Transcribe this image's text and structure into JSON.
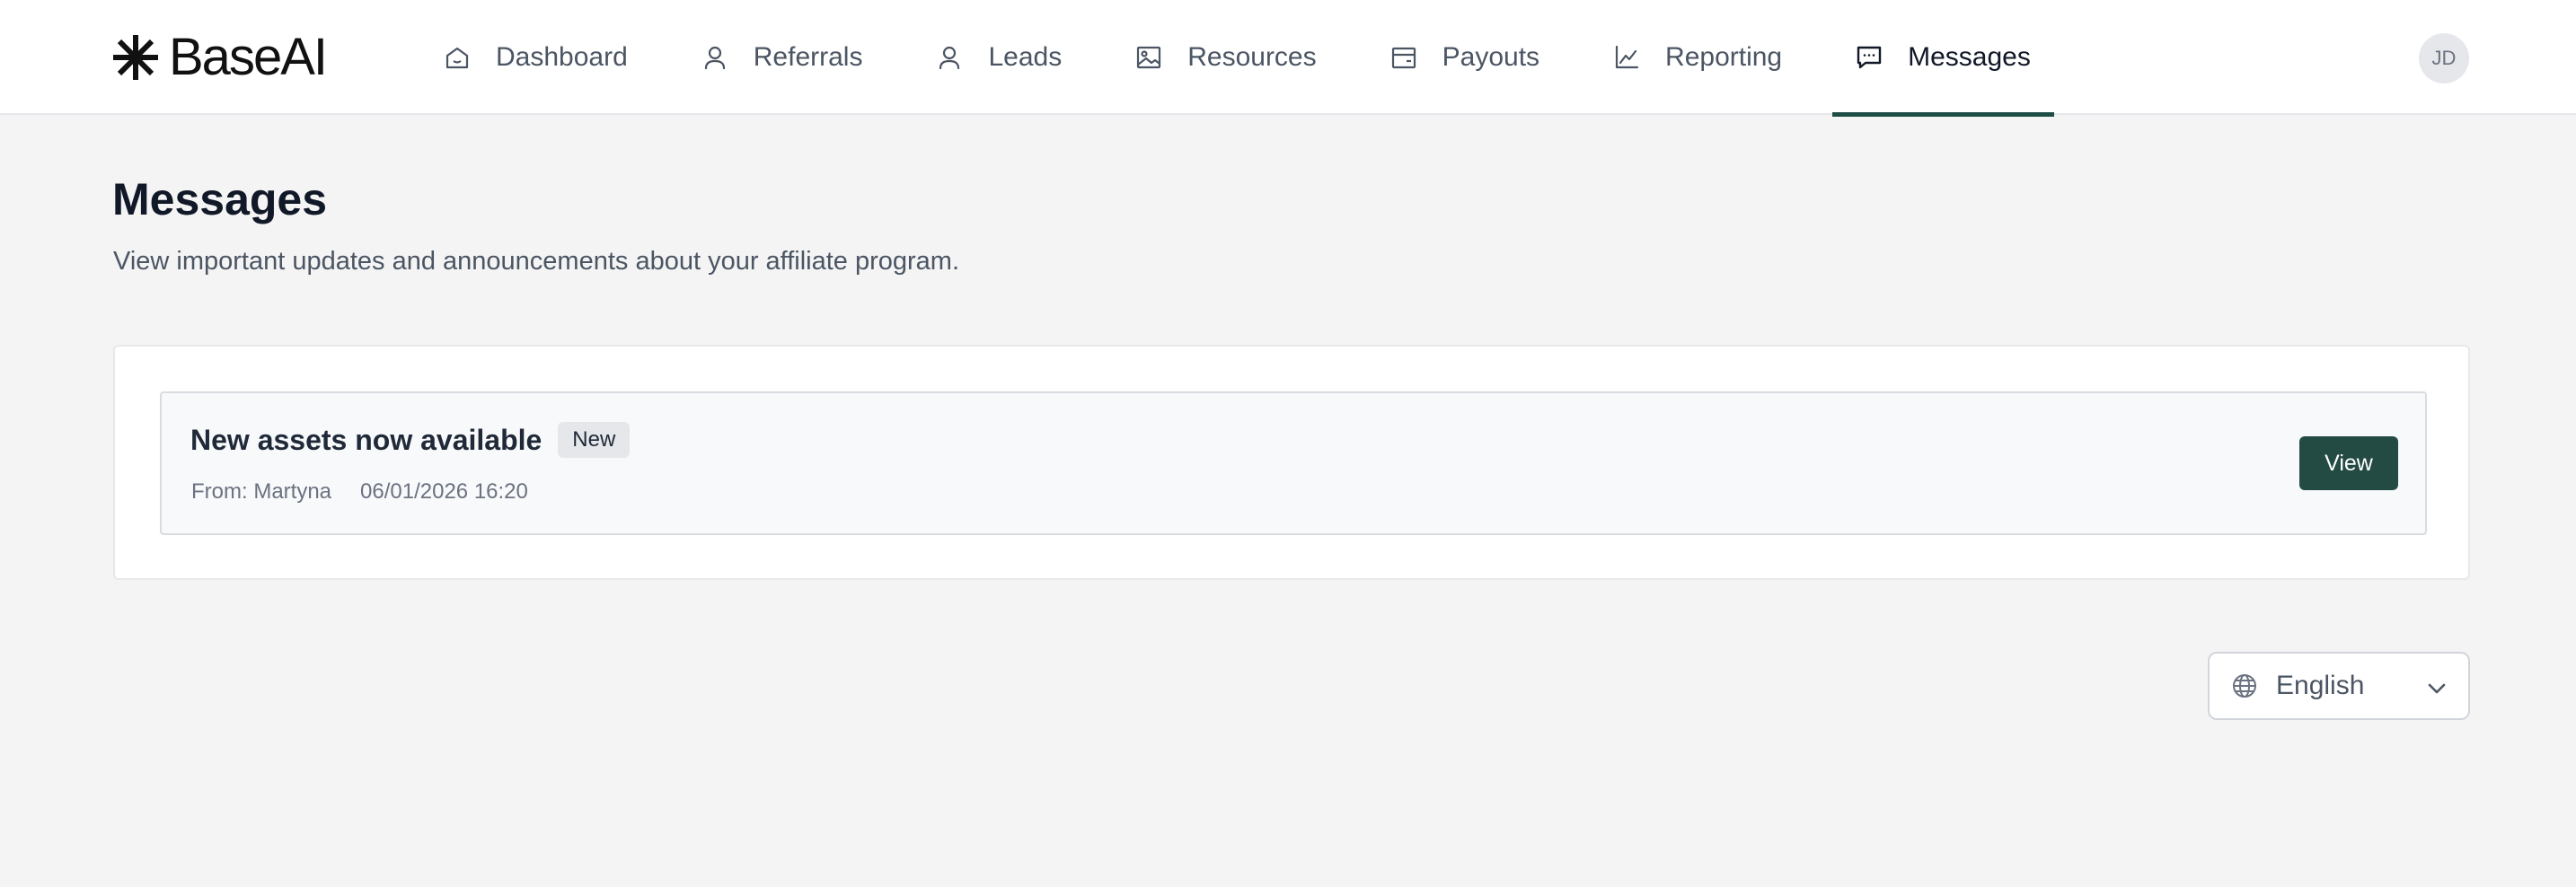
{
  "app": {
    "brand": "BaseAI"
  },
  "nav": {
    "items": [
      {
        "label": "Dashboard",
        "icon": "home-icon"
      },
      {
        "label": "Referrals",
        "icon": "user-icon"
      },
      {
        "label": "Leads",
        "icon": "user-icon"
      },
      {
        "label": "Resources",
        "icon": "image-icon"
      },
      {
        "label": "Payouts",
        "icon": "wallet-icon"
      },
      {
        "label": "Reporting",
        "icon": "line-chart-icon"
      },
      {
        "label": "Messages",
        "icon": "message-icon",
        "active": true
      }
    ],
    "avatar_initials": "JD"
  },
  "page": {
    "title": "Messages",
    "subtitle": "View important updates and announcements about your affiliate program."
  },
  "messages": [
    {
      "title": "New assets now available",
      "badge": "New",
      "from": "From: Martyna",
      "timestamp": "06/01/2026 16:20",
      "action_label": "View"
    }
  ],
  "language": {
    "selected": "English",
    "icon": "globe-icon"
  },
  "colors": {
    "accent": "#1e4d45",
    "button": "#234a43",
    "background": "#f4f4f4"
  }
}
